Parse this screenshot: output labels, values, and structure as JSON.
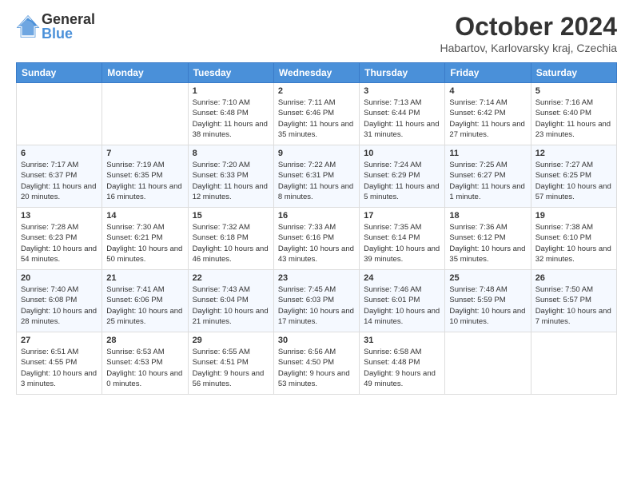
{
  "logo": {
    "general": "General",
    "blue": "Blue"
  },
  "title": "October 2024",
  "location": "Habartov, Karlovarsky kraj, Czechia",
  "days_of_week": [
    "Sunday",
    "Monday",
    "Tuesday",
    "Wednesday",
    "Thursday",
    "Friday",
    "Saturday"
  ],
  "weeks": [
    [
      {
        "day": null
      },
      {
        "day": null
      },
      {
        "day": "1",
        "sunrise": "Sunrise: 7:10 AM",
        "sunset": "Sunset: 6:48 PM",
        "daylight": "Daylight: 11 hours and 38 minutes."
      },
      {
        "day": "2",
        "sunrise": "Sunrise: 7:11 AM",
        "sunset": "Sunset: 6:46 PM",
        "daylight": "Daylight: 11 hours and 35 minutes."
      },
      {
        "day": "3",
        "sunrise": "Sunrise: 7:13 AM",
        "sunset": "Sunset: 6:44 PM",
        "daylight": "Daylight: 11 hours and 31 minutes."
      },
      {
        "day": "4",
        "sunrise": "Sunrise: 7:14 AM",
        "sunset": "Sunset: 6:42 PM",
        "daylight": "Daylight: 11 hours and 27 minutes."
      },
      {
        "day": "5",
        "sunrise": "Sunrise: 7:16 AM",
        "sunset": "Sunset: 6:40 PM",
        "daylight": "Daylight: 11 hours and 23 minutes."
      }
    ],
    [
      {
        "day": "6",
        "sunrise": "Sunrise: 7:17 AM",
        "sunset": "Sunset: 6:37 PM",
        "daylight": "Daylight: 11 hours and 20 minutes."
      },
      {
        "day": "7",
        "sunrise": "Sunrise: 7:19 AM",
        "sunset": "Sunset: 6:35 PM",
        "daylight": "Daylight: 11 hours and 16 minutes."
      },
      {
        "day": "8",
        "sunrise": "Sunrise: 7:20 AM",
        "sunset": "Sunset: 6:33 PM",
        "daylight": "Daylight: 11 hours and 12 minutes."
      },
      {
        "day": "9",
        "sunrise": "Sunrise: 7:22 AM",
        "sunset": "Sunset: 6:31 PM",
        "daylight": "Daylight: 11 hours and 8 minutes."
      },
      {
        "day": "10",
        "sunrise": "Sunrise: 7:24 AM",
        "sunset": "Sunset: 6:29 PM",
        "daylight": "Daylight: 11 hours and 5 minutes."
      },
      {
        "day": "11",
        "sunrise": "Sunrise: 7:25 AM",
        "sunset": "Sunset: 6:27 PM",
        "daylight": "Daylight: 11 hours and 1 minute."
      },
      {
        "day": "12",
        "sunrise": "Sunrise: 7:27 AM",
        "sunset": "Sunset: 6:25 PM",
        "daylight": "Daylight: 10 hours and 57 minutes."
      }
    ],
    [
      {
        "day": "13",
        "sunrise": "Sunrise: 7:28 AM",
        "sunset": "Sunset: 6:23 PM",
        "daylight": "Daylight: 10 hours and 54 minutes."
      },
      {
        "day": "14",
        "sunrise": "Sunrise: 7:30 AM",
        "sunset": "Sunset: 6:21 PM",
        "daylight": "Daylight: 10 hours and 50 minutes."
      },
      {
        "day": "15",
        "sunrise": "Sunrise: 7:32 AM",
        "sunset": "Sunset: 6:18 PM",
        "daylight": "Daylight: 10 hours and 46 minutes."
      },
      {
        "day": "16",
        "sunrise": "Sunrise: 7:33 AM",
        "sunset": "Sunset: 6:16 PM",
        "daylight": "Daylight: 10 hours and 43 minutes."
      },
      {
        "day": "17",
        "sunrise": "Sunrise: 7:35 AM",
        "sunset": "Sunset: 6:14 PM",
        "daylight": "Daylight: 10 hours and 39 minutes."
      },
      {
        "day": "18",
        "sunrise": "Sunrise: 7:36 AM",
        "sunset": "Sunset: 6:12 PM",
        "daylight": "Daylight: 10 hours and 35 minutes."
      },
      {
        "day": "19",
        "sunrise": "Sunrise: 7:38 AM",
        "sunset": "Sunset: 6:10 PM",
        "daylight": "Daylight: 10 hours and 32 minutes."
      }
    ],
    [
      {
        "day": "20",
        "sunrise": "Sunrise: 7:40 AM",
        "sunset": "Sunset: 6:08 PM",
        "daylight": "Daylight: 10 hours and 28 minutes."
      },
      {
        "day": "21",
        "sunrise": "Sunrise: 7:41 AM",
        "sunset": "Sunset: 6:06 PM",
        "daylight": "Daylight: 10 hours and 25 minutes."
      },
      {
        "day": "22",
        "sunrise": "Sunrise: 7:43 AM",
        "sunset": "Sunset: 6:04 PM",
        "daylight": "Daylight: 10 hours and 21 minutes."
      },
      {
        "day": "23",
        "sunrise": "Sunrise: 7:45 AM",
        "sunset": "Sunset: 6:03 PM",
        "daylight": "Daylight: 10 hours and 17 minutes."
      },
      {
        "day": "24",
        "sunrise": "Sunrise: 7:46 AM",
        "sunset": "Sunset: 6:01 PM",
        "daylight": "Daylight: 10 hours and 14 minutes."
      },
      {
        "day": "25",
        "sunrise": "Sunrise: 7:48 AM",
        "sunset": "Sunset: 5:59 PM",
        "daylight": "Daylight: 10 hours and 10 minutes."
      },
      {
        "day": "26",
        "sunrise": "Sunrise: 7:50 AM",
        "sunset": "Sunset: 5:57 PM",
        "daylight": "Daylight: 10 hours and 7 minutes."
      }
    ],
    [
      {
        "day": "27",
        "sunrise": "Sunrise: 6:51 AM",
        "sunset": "Sunset: 4:55 PM",
        "daylight": "Daylight: 10 hours and 3 minutes."
      },
      {
        "day": "28",
        "sunrise": "Sunrise: 6:53 AM",
        "sunset": "Sunset: 4:53 PM",
        "daylight": "Daylight: 10 hours and 0 minutes."
      },
      {
        "day": "29",
        "sunrise": "Sunrise: 6:55 AM",
        "sunset": "Sunset: 4:51 PM",
        "daylight": "Daylight: 9 hours and 56 minutes."
      },
      {
        "day": "30",
        "sunrise": "Sunrise: 6:56 AM",
        "sunset": "Sunset: 4:50 PM",
        "daylight": "Daylight: 9 hours and 53 minutes."
      },
      {
        "day": "31",
        "sunrise": "Sunrise: 6:58 AM",
        "sunset": "Sunset: 4:48 PM",
        "daylight": "Daylight: 9 hours and 49 minutes."
      },
      {
        "day": null
      },
      {
        "day": null
      }
    ]
  ]
}
